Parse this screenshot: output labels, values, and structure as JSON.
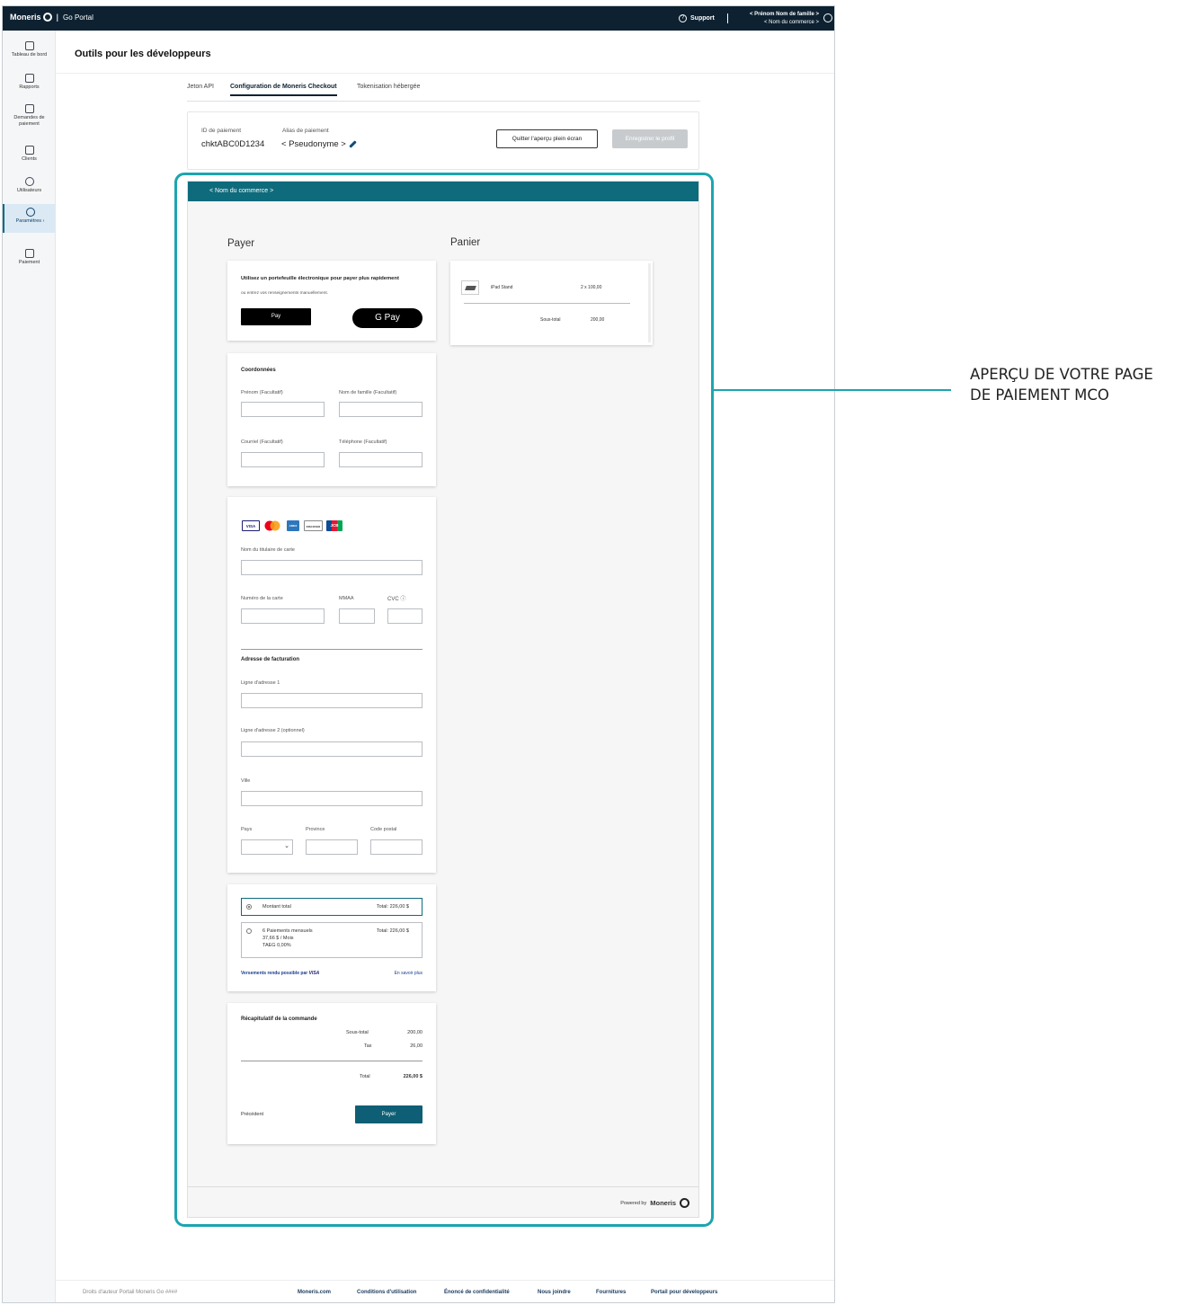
{
  "topbar": {
    "brand": "Moneris",
    "product": "Go Portal",
    "support": "Support",
    "user_name": "< Prénom Nom de famille >",
    "merchant_name": "< Nom du commerce >"
  },
  "sidebar": {
    "items": [
      {
        "label": "Tableau de bord"
      },
      {
        "label": "Rapports"
      },
      {
        "label": "Demandes de paiement"
      },
      {
        "label": "Clients"
      },
      {
        "label": "Utilisateurs"
      },
      {
        "label": "Paramètres ›"
      },
      {
        "label": "Paiement"
      }
    ]
  },
  "page": {
    "title": "Outils pour les développeurs"
  },
  "tabs": [
    {
      "label": "Jeton API"
    },
    {
      "label": "Configuration de Moneris Checkout"
    },
    {
      "label": "Tokenisation hébergée"
    }
  ],
  "profile": {
    "id_label": "ID de paiement",
    "id_value": "chktABC0D1234",
    "alias_label": "Alias de paiement",
    "alias_value": "< Pseudonyme >",
    "exit_button": "Quitter l'aperçu plein écran",
    "save_button": "Enregistrer le profil"
  },
  "checkout": {
    "merchant_header": "< Nom du commerce >",
    "pay_heading": "Payer",
    "cart_heading": "Panier",
    "wallet": {
      "title": "Utilisez un portefeuille électronique pour payer plus rapidement",
      "subtitle": "ou entrez vos renseignements manuellement.",
      "apple_pay": " Pay",
      "google_pay": "G Pay"
    },
    "contact": {
      "title": "Coordonnées",
      "first_name": "Prénom (Facultatif)",
      "last_name": "Nom de famille (Facultatif)",
      "email": "Courriel (Facultatif)",
      "phone": "Téléphone (Facultatif)"
    },
    "card": {
      "logos": [
        "VISA",
        "MC",
        "AMEX",
        "DISCOVER",
        "JCB"
      ],
      "holder": "Nom du titulaire de carte",
      "number": "Numéro de la carte",
      "expiry": "MMAA",
      "cvc": "CVC ⓘ"
    },
    "billing": {
      "title": "Adresse de facturation",
      "line1": "Ligne d'adresse 1",
      "line2": "Ligne d'adresse 2 (optionnel)",
      "city": "Ville",
      "country": "Pays",
      "province": "Province",
      "postal": "Code postal"
    },
    "installments": {
      "option1_label": "Montant total",
      "option1_total": "Total: 226,00 $",
      "option2_label": "6 Paiements mensuels",
      "option2_amount": "37,66 $ / Mois",
      "option2_rate": "TAEG 0,00%",
      "option2_total": "Total: 226,00 $",
      "powered_text": "Versements rendu possible par",
      "powered_brand": "VISA",
      "learn_more": "En savoir plus"
    },
    "summary": {
      "title": "Récapitulatif de la commande",
      "subtotal_label": "Sous-total",
      "subtotal_value": "200,00",
      "tax_label": "Tax",
      "tax_value": "26,00",
      "total_label": "Total",
      "total_value": "226,00 $",
      "back": "Précédent",
      "pay": "Payer"
    },
    "cart": {
      "item_name": "iPad Stand",
      "item_qty": "2 x 100,00",
      "subtotal_label": "Sous-total",
      "subtotal_value": "200,00"
    },
    "powered_by": "Powered by",
    "powered_brand": "Moneris"
  },
  "footer": {
    "copyright": "Droits d'auteur Portail Moneris Go ####",
    "links": [
      {
        "label": "Moneris.com"
      },
      {
        "label": "Conditions d'utilisation"
      },
      {
        "label": "Énoncé de confidentialité"
      },
      {
        "label": "Nous joindre"
      },
      {
        "label": "Fournitures"
      },
      {
        "label": "Portail pour développeurs"
      }
    ]
  },
  "callout": {
    "line1": "APERÇU DE VOTRE PAGE",
    "line2": "DE PAIEMENT MCO"
  },
  "colors": {
    "topbar": "#0d2131",
    "mco_header": "#0e6b7c",
    "highlight": "#1ba5b0",
    "pay_button": "#0e5f75"
  }
}
